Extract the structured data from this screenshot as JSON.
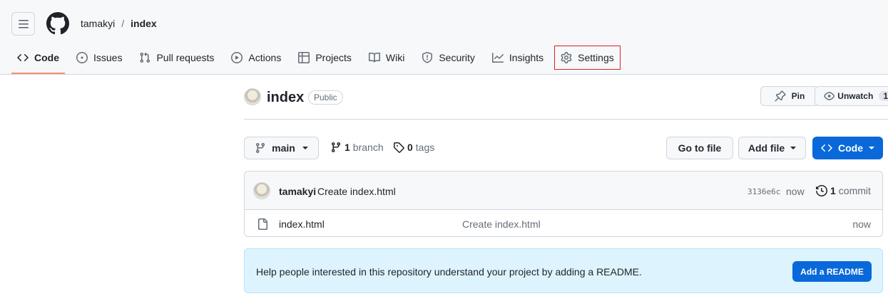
{
  "header": {
    "breadcrumb": {
      "owner": "tamakyi",
      "separator": "/",
      "repo": "index"
    },
    "icons": {
      "menu": "hamburger-icon",
      "logo": "github-mark-icon"
    }
  },
  "tabs": [
    {
      "label": "Code",
      "icon": "code-icon",
      "active": true
    },
    {
      "label": "Issues",
      "icon": "issue-opened-icon"
    },
    {
      "label": "Pull requests",
      "icon": "git-pull-request-icon"
    },
    {
      "label": "Actions",
      "icon": "play-icon"
    },
    {
      "label": "Projects",
      "icon": "table-icon"
    },
    {
      "label": "Wiki",
      "icon": "book-icon"
    },
    {
      "label": "Security",
      "icon": "shield-icon"
    },
    {
      "label": "Insights",
      "icon": "graph-icon"
    },
    {
      "label": "Settings",
      "icon": "gear-icon",
      "highlighted": true
    }
  ],
  "repo": {
    "name": "index",
    "visibility": "Public",
    "pin_label": "Pin",
    "unwatch_label": "Unwatch",
    "watch_count": "1"
  },
  "toolbar": {
    "branch": "main",
    "branch_count": "1",
    "branch_label": "branch",
    "tag_count": "0",
    "tag_label": "tags",
    "go_to_file": "Go to file",
    "add_file": "Add file",
    "code": "Code"
  },
  "latest_commit": {
    "author": "tamakyi",
    "message": "Create index.html",
    "sha": "3136e6c",
    "time": "now",
    "commit_count": "1",
    "commit_label": "commit"
  },
  "files": [
    {
      "name": "index.html",
      "message": "Create index.html",
      "time": "now"
    }
  ],
  "readme_banner": {
    "text": "Help people interested in this repository understand your project by adding a README.",
    "button": "Add a README"
  },
  "colors": {
    "accent": "#0969da",
    "active_tab_underline": "#fd8c73",
    "highlight_box": "#e0202a",
    "banner_bg": "#ddf4ff"
  }
}
